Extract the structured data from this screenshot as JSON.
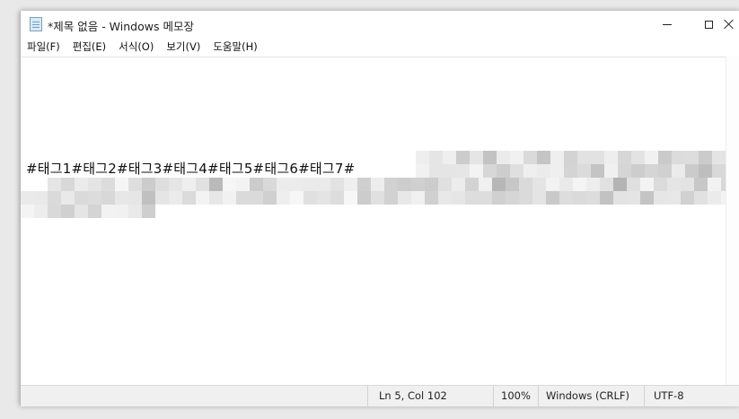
{
  "window": {
    "title": "*제목 없음 - Windows 메모장"
  },
  "menu": {
    "items": [
      "파일(F)",
      "편집(E)",
      "서식(O)",
      "보기(V)",
      "도움말(H)"
    ]
  },
  "editor": {
    "lines": [
      "#태그1#태그2#태그3#태그4#태그5#태그6#태그7#"
    ]
  },
  "status": {
    "position": "Ln 5, Col 102",
    "zoom": "100%",
    "line_ending": "Windows (CRLF)",
    "encoding": "UTF-8"
  },
  "icons": {
    "app": "notepad-icon",
    "minimize": "minimize-icon",
    "maximize": "maximize-icon",
    "close": "close-icon"
  },
  "colors": {
    "window_bg": "#ffffff",
    "status_bg": "#f0f0f0",
    "text": "#111111"
  }
}
